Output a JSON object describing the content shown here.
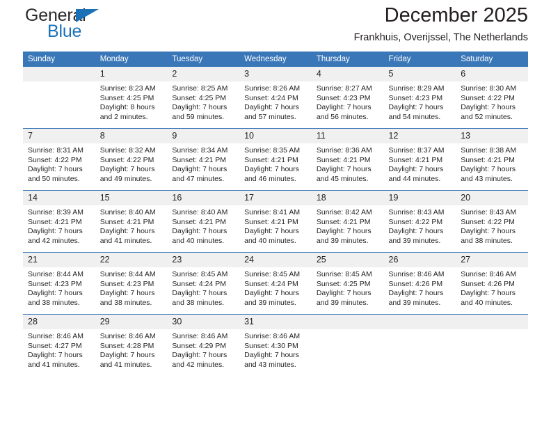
{
  "brand": {
    "name_part1": "General",
    "name_part2": "Blue",
    "triangle_color": "#1a71b8"
  },
  "header": {
    "title": "December 2025",
    "subtitle": "Frankhuis, Overijssel, The Netherlands"
  },
  "colors": {
    "header_row": "#3a77b8",
    "daynum_bg": "#f0f0f0",
    "text": "#231f20"
  },
  "weekday_headers": [
    "Sunday",
    "Monday",
    "Tuesday",
    "Wednesday",
    "Thursday",
    "Friday",
    "Saturday"
  ],
  "labels": {
    "sunrise_prefix": "Sunrise: ",
    "sunset_prefix": "Sunset: ",
    "daylight_prefix": "Daylight: "
  },
  "weeks": [
    [
      {
        "day": "",
        "empty": true
      },
      {
        "day": "1",
        "sunrise": "Sunrise: 8:23 AM",
        "sunset": "Sunset: 4:25 PM",
        "daylight1": "Daylight: 8 hours",
        "daylight2": "and 2 minutes."
      },
      {
        "day": "2",
        "sunrise": "Sunrise: 8:25 AM",
        "sunset": "Sunset: 4:25 PM",
        "daylight1": "Daylight: 7 hours",
        "daylight2": "and 59 minutes."
      },
      {
        "day": "3",
        "sunrise": "Sunrise: 8:26 AM",
        "sunset": "Sunset: 4:24 PM",
        "daylight1": "Daylight: 7 hours",
        "daylight2": "and 57 minutes."
      },
      {
        "day": "4",
        "sunrise": "Sunrise: 8:27 AM",
        "sunset": "Sunset: 4:23 PM",
        "daylight1": "Daylight: 7 hours",
        "daylight2": "and 56 minutes."
      },
      {
        "day": "5",
        "sunrise": "Sunrise: 8:29 AM",
        "sunset": "Sunset: 4:23 PM",
        "daylight1": "Daylight: 7 hours",
        "daylight2": "and 54 minutes."
      },
      {
        "day": "6",
        "sunrise": "Sunrise: 8:30 AM",
        "sunset": "Sunset: 4:22 PM",
        "daylight1": "Daylight: 7 hours",
        "daylight2": "and 52 minutes."
      }
    ],
    [
      {
        "day": "7",
        "sunrise": "Sunrise: 8:31 AM",
        "sunset": "Sunset: 4:22 PM",
        "daylight1": "Daylight: 7 hours",
        "daylight2": "and 50 minutes."
      },
      {
        "day": "8",
        "sunrise": "Sunrise: 8:32 AM",
        "sunset": "Sunset: 4:22 PM",
        "daylight1": "Daylight: 7 hours",
        "daylight2": "and 49 minutes."
      },
      {
        "day": "9",
        "sunrise": "Sunrise: 8:34 AM",
        "sunset": "Sunset: 4:21 PM",
        "daylight1": "Daylight: 7 hours",
        "daylight2": "and 47 minutes."
      },
      {
        "day": "10",
        "sunrise": "Sunrise: 8:35 AM",
        "sunset": "Sunset: 4:21 PM",
        "daylight1": "Daylight: 7 hours",
        "daylight2": "and 46 minutes."
      },
      {
        "day": "11",
        "sunrise": "Sunrise: 8:36 AM",
        "sunset": "Sunset: 4:21 PM",
        "daylight1": "Daylight: 7 hours",
        "daylight2": "and 45 minutes."
      },
      {
        "day": "12",
        "sunrise": "Sunrise: 8:37 AM",
        "sunset": "Sunset: 4:21 PM",
        "daylight1": "Daylight: 7 hours",
        "daylight2": "and 44 minutes."
      },
      {
        "day": "13",
        "sunrise": "Sunrise: 8:38 AM",
        "sunset": "Sunset: 4:21 PM",
        "daylight1": "Daylight: 7 hours",
        "daylight2": "and 43 minutes."
      }
    ],
    [
      {
        "day": "14",
        "sunrise": "Sunrise: 8:39 AM",
        "sunset": "Sunset: 4:21 PM",
        "daylight1": "Daylight: 7 hours",
        "daylight2": "and 42 minutes."
      },
      {
        "day": "15",
        "sunrise": "Sunrise: 8:40 AM",
        "sunset": "Sunset: 4:21 PM",
        "daylight1": "Daylight: 7 hours",
        "daylight2": "and 41 minutes."
      },
      {
        "day": "16",
        "sunrise": "Sunrise: 8:40 AM",
        "sunset": "Sunset: 4:21 PM",
        "daylight1": "Daylight: 7 hours",
        "daylight2": "and 40 minutes."
      },
      {
        "day": "17",
        "sunrise": "Sunrise: 8:41 AM",
        "sunset": "Sunset: 4:21 PM",
        "daylight1": "Daylight: 7 hours",
        "daylight2": "and 40 minutes."
      },
      {
        "day": "18",
        "sunrise": "Sunrise: 8:42 AM",
        "sunset": "Sunset: 4:21 PM",
        "daylight1": "Daylight: 7 hours",
        "daylight2": "and 39 minutes."
      },
      {
        "day": "19",
        "sunrise": "Sunrise: 8:43 AM",
        "sunset": "Sunset: 4:22 PM",
        "daylight1": "Daylight: 7 hours",
        "daylight2": "and 39 minutes."
      },
      {
        "day": "20",
        "sunrise": "Sunrise: 8:43 AM",
        "sunset": "Sunset: 4:22 PM",
        "daylight1": "Daylight: 7 hours",
        "daylight2": "and 38 minutes."
      }
    ],
    [
      {
        "day": "21",
        "sunrise": "Sunrise: 8:44 AM",
        "sunset": "Sunset: 4:23 PM",
        "daylight1": "Daylight: 7 hours",
        "daylight2": "and 38 minutes."
      },
      {
        "day": "22",
        "sunrise": "Sunrise: 8:44 AM",
        "sunset": "Sunset: 4:23 PM",
        "daylight1": "Daylight: 7 hours",
        "daylight2": "and 38 minutes."
      },
      {
        "day": "23",
        "sunrise": "Sunrise: 8:45 AM",
        "sunset": "Sunset: 4:24 PM",
        "daylight1": "Daylight: 7 hours",
        "daylight2": "and 38 minutes."
      },
      {
        "day": "24",
        "sunrise": "Sunrise: 8:45 AM",
        "sunset": "Sunset: 4:24 PM",
        "daylight1": "Daylight: 7 hours",
        "daylight2": "and 39 minutes."
      },
      {
        "day": "25",
        "sunrise": "Sunrise: 8:45 AM",
        "sunset": "Sunset: 4:25 PM",
        "daylight1": "Daylight: 7 hours",
        "daylight2": "and 39 minutes."
      },
      {
        "day": "26",
        "sunrise": "Sunrise: 8:46 AM",
        "sunset": "Sunset: 4:26 PM",
        "daylight1": "Daylight: 7 hours",
        "daylight2": "and 39 minutes."
      },
      {
        "day": "27",
        "sunrise": "Sunrise: 8:46 AM",
        "sunset": "Sunset: 4:26 PM",
        "daylight1": "Daylight: 7 hours",
        "daylight2": "and 40 minutes."
      }
    ],
    [
      {
        "day": "28",
        "sunrise": "Sunrise: 8:46 AM",
        "sunset": "Sunset: 4:27 PM",
        "daylight1": "Daylight: 7 hours",
        "daylight2": "and 41 minutes."
      },
      {
        "day": "29",
        "sunrise": "Sunrise: 8:46 AM",
        "sunset": "Sunset: 4:28 PM",
        "daylight1": "Daylight: 7 hours",
        "daylight2": "and 41 minutes."
      },
      {
        "day": "30",
        "sunrise": "Sunrise: 8:46 AM",
        "sunset": "Sunset: 4:29 PM",
        "daylight1": "Daylight: 7 hours",
        "daylight2": "and 42 minutes."
      },
      {
        "day": "31",
        "sunrise": "Sunrise: 8:46 AM",
        "sunset": "Sunset: 4:30 PM",
        "daylight1": "Daylight: 7 hours",
        "daylight2": "and 43 minutes."
      },
      {
        "day": "",
        "empty": true
      },
      {
        "day": "",
        "empty": true
      },
      {
        "day": "",
        "empty": true
      }
    ]
  ]
}
